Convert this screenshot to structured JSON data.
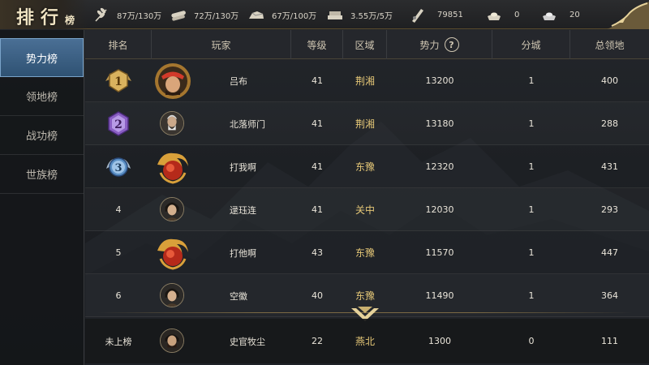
{
  "header": {
    "title": "排行",
    "title_small": "榜"
  },
  "resources": [
    {
      "icon": "grain-icon",
      "value": "87万/130万"
    },
    {
      "icon": "wood-icon",
      "value": "72万/130万"
    },
    {
      "icon": "stone-icon",
      "value": "67万/100万"
    },
    {
      "icon": "iron-icon",
      "value": "3.55万/5万"
    },
    {
      "icon": "copper-coin-icon",
      "value": "79851"
    },
    {
      "icon": "gold-ingot-icon",
      "value": "0"
    },
    {
      "icon": "silver-ingot-icon",
      "value": "20"
    }
  ],
  "sidebar": {
    "items": [
      {
        "label": "势力榜",
        "active": true
      },
      {
        "label": "领地榜",
        "active": false
      },
      {
        "label": "战功榜",
        "active": false
      },
      {
        "label": "世族榜",
        "active": false
      }
    ]
  },
  "table": {
    "headers": [
      "排名",
      "玩家",
      "等级",
      "区域",
      "势力",
      "分城",
      "总领地"
    ],
    "rows": [
      {
        "rank": "1",
        "medal": "gold",
        "player": "吕布",
        "avatar": "bandana-warrior",
        "level": "41",
        "region": "荆湘",
        "power": "13200",
        "cities": "1",
        "territory": "400"
      },
      {
        "rank": "2",
        "medal": "purple",
        "player": "北落师门",
        "avatar": "old-sage",
        "level": "41",
        "region": "荆湘",
        "power": "13180",
        "cities": "1",
        "territory": "288"
      },
      {
        "rank": "3",
        "medal": "blue",
        "player": "打我啊",
        "avatar": "dragon-crest",
        "level": "41",
        "region": "东豫",
        "power": "12320",
        "cities": "1",
        "territory": "431"
      },
      {
        "rank": "4",
        "medal": "",
        "player": "逯珏连",
        "avatar": "young-general",
        "level": "41",
        "region": "关中",
        "power": "12030",
        "cities": "1",
        "territory": "293"
      },
      {
        "rank": "5",
        "medal": "",
        "player": "打他啊",
        "avatar": "dragon-crest",
        "level": "43",
        "region": "东豫",
        "power": "11570",
        "cities": "1",
        "territory": "447"
      },
      {
        "rank": "6",
        "medal": "",
        "player": "空徽",
        "avatar": "young-general",
        "level": "40",
        "region": "东豫",
        "power": "11490",
        "cities": "1",
        "territory": "364"
      }
    ],
    "self_row": {
      "rank": "未上榜",
      "player": "史官牧尘",
      "avatar": "bearded-general",
      "level": "22",
      "region": "燕北",
      "power": "1300",
      "cities": "0",
      "territory": "111"
    }
  },
  "colors": {
    "active_tab": "#3d6388",
    "gold_text": "#e5c777",
    "border_gold": "#7c6a44"
  }
}
